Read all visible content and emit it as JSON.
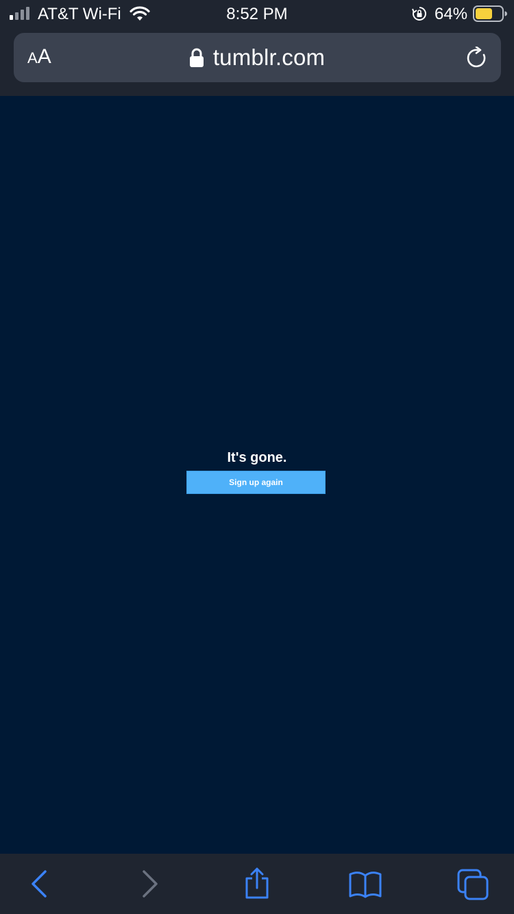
{
  "status_bar": {
    "carrier": "AT&T Wi-Fi",
    "time": "8:52 PM",
    "battery_percent": "64%",
    "battery_level": 0.64,
    "icons": [
      "signal-icon",
      "wifi-icon",
      "rotation-lock-icon",
      "battery-icon"
    ]
  },
  "address_bar": {
    "text_size_label_small": "A",
    "text_size_label_large": "A",
    "url": "tumblr.com",
    "icons": [
      "lock-icon",
      "reload-icon"
    ]
  },
  "page": {
    "message": "It's gone.",
    "signup_button_label": "Sign up again"
  },
  "toolbar": {
    "icons": [
      "back-icon",
      "forward-icon",
      "share-icon",
      "bookmarks-icon",
      "tabs-icon"
    ]
  },
  "colors": {
    "page_background": "#001935",
    "chrome_background": "#1f2530",
    "address_field": "#3b4250",
    "button_blue": "#4fb1f9",
    "toolbar_active_icon": "#3b82f6",
    "toolbar_disabled_icon": "#6b7280",
    "battery_fill": "#f7d13d"
  }
}
